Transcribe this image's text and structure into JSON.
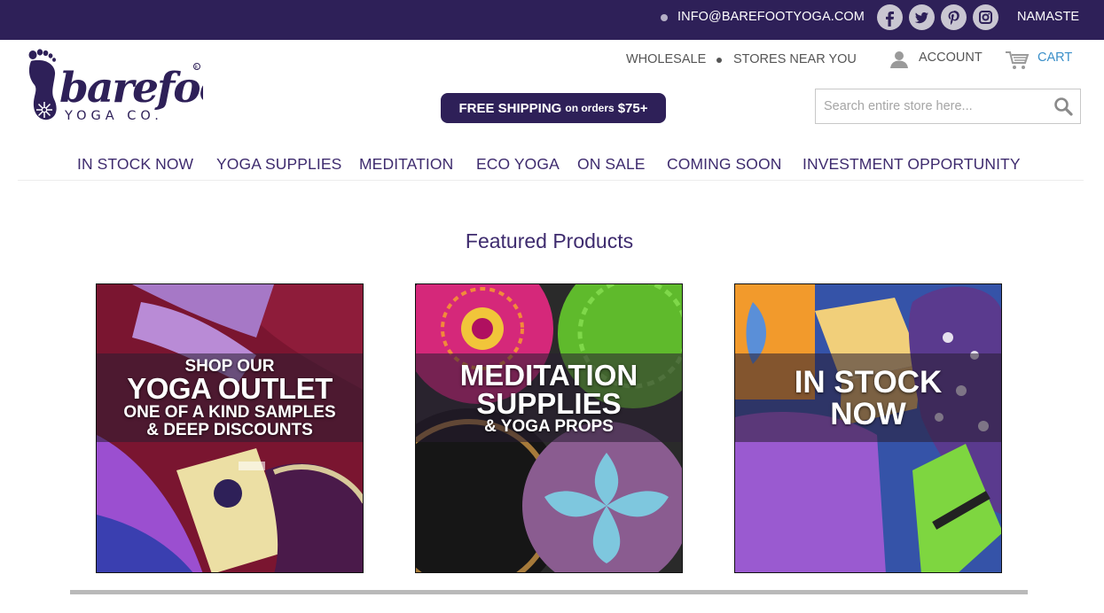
{
  "topbar": {
    "email": "INFO@BAREFOOTYOGA.COM",
    "social": [
      "facebook-icon",
      "twitter-icon",
      "pinterest-icon",
      "instagram-icon"
    ],
    "greeting": "NAMASTE"
  },
  "header": {
    "logo_text": "barefoot",
    "logo_sub": "YOGA CO.",
    "utility": {
      "wholesale": "WHOLESALE",
      "stores": "STORES NEAR YOU",
      "account": "ACCOUNT",
      "cart": "CART"
    },
    "shipping": {
      "main": "FREE SHIPPING",
      "small": "on orders",
      "amount": "$75+"
    },
    "search": {
      "placeholder": "Search entire store here..."
    }
  },
  "nav": {
    "items": [
      "IN STOCK NOW",
      "YOGA SUPPLIES",
      "MEDITATION",
      "ECO YOGA",
      "ON SALE",
      "COMING SOON",
      "INVESTMENT OPPORTUNITY"
    ]
  },
  "featured": {
    "title": "Featured Products",
    "cards": [
      {
        "l1": "SHOP OUR",
        "l2": "YOGA OUTLET",
        "l3": "ONE OF A KIND SAMPLES",
        "l4": "& DEEP DISCOUNTS"
      },
      {
        "l1": "MEDITATION",
        "l2": "SUPPLIES",
        "l3": "& YOGA PROPS"
      },
      {
        "l1": "IN STOCK",
        "l2": "NOW"
      }
    ]
  },
  "colors": {
    "brand_purple": "#2e2058",
    "nav_text": "#3e2b6e",
    "cart_blue": "#3a8fc9"
  }
}
